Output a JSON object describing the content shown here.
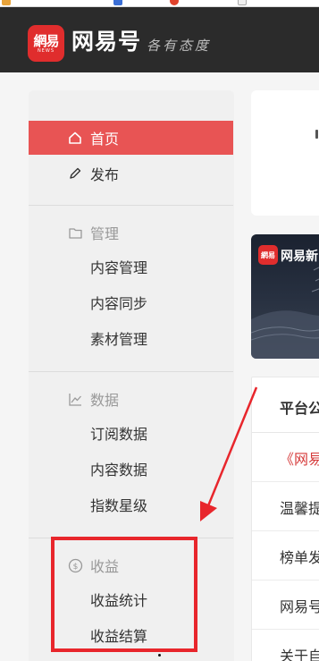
{
  "header": {
    "logo_text": "網易",
    "logo_sub": "NEWS",
    "brand": "网易号",
    "slogan": "各有态度"
  },
  "sidebar": {
    "main_items": [
      {
        "label": "首页",
        "icon": "home-icon",
        "active": true
      },
      {
        "label": "发布",
        "icon": "pencil-icon",
        "active": false
      }
    ],
    "sections": [
      {
        "title": "管理",
        "icon": "folder-icon",
        "items": [
          "内容管理",
          "内容同步",
          "素材管理"
        ]
      },
      {
        "title": "数据",
        "icon": "chart-line-icon",
        "items": [
          "订阅数据",
          "内容数据",
          "指数星级"
        ]
      },
      {
        "title": "收益",
        "icon": "dollar-circle-icon",
        "items": [
          "收益统计",
          "收益结算"
        ]
      }
    ]
  },
  "banner": {
    "logo_text": "網易",
    "text": "网易新"
  },
  "notice": {
    "title": "平台公",
    "rows": [
      {
        "text": "《网易",
        "highlight": true
      },
      {
        "text": "温馨提",
        "highlight": false
      },
      {
        "text": "榜单发",
        "highlight": false
      },
      {
        "text": "网易号",
        "highlight": false
      },
      {
        "text": "关于自",
        "highlight": false
      }
    ]
  },
  "colors": {
    "accent": "#e85454",
    "header_bg": "#2b2b2b",
    "annotation": "#e8262c"
  }
}
